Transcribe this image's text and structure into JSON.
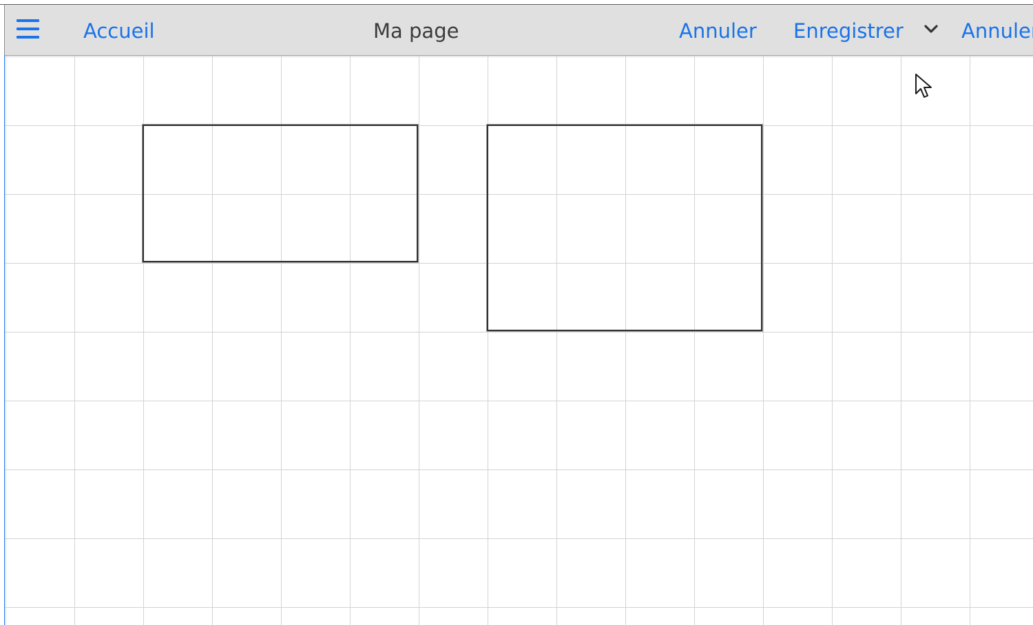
{
  "toolbar": {
    "menu_icon": "hamburger-menu-icon",
    "home_label": "Accueil",
    "page_title": "Ma page",
    "cancel_label": "Annuler",
    "save_label": "Enregistrer",
    "dropdown_icon": "chevron-down-icon",
    "cancel_label_2": "Annuler"
  },
  "canvas": {
    "grid": true,
    "shapes": [
      {
        "type": "rectangle"
      },
      {
        "type": "rectangle"
      }
    ]
  },
  "colors": {
    "accent": "#1a73e8",
    "toolbar_bg": "#e0e0e0",
    "grid_line": "#d3d3d3",
    "shape_border": "#2e2e2e",
    "title_text": "#3c3c3c"
  }
}
